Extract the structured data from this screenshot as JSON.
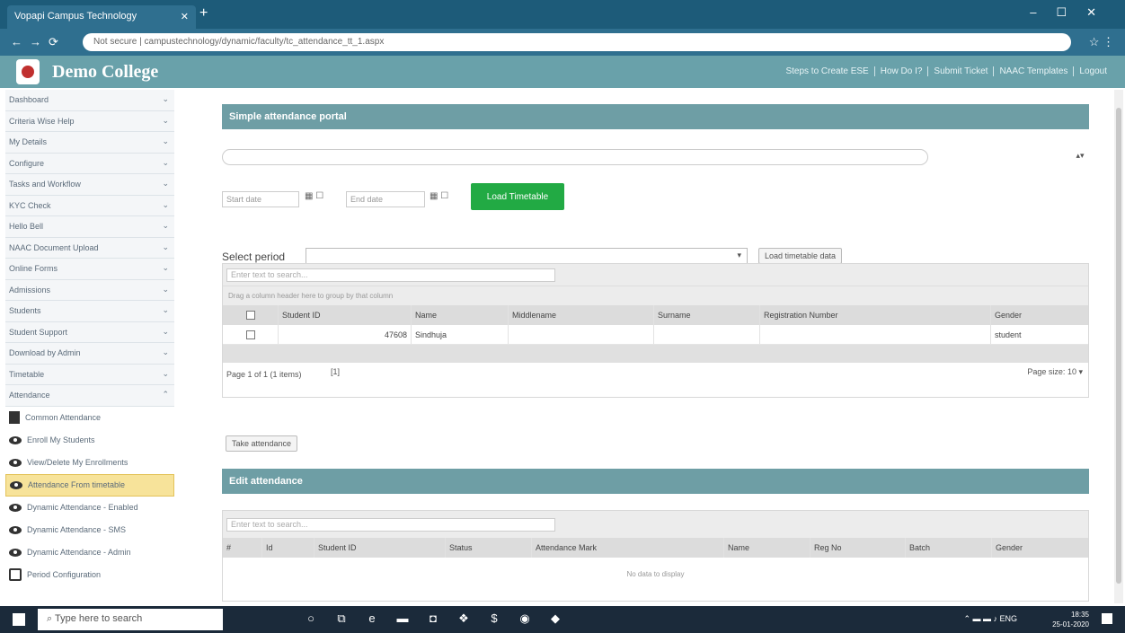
{
  "browser": {
    "tab_title": "Vopapi Campus Technology",
    "url": "Not secure | campustechnology/dynamic/faculty/tc_attendance_tt_1.aspx"
  },
  "header": {
    "college_name": "Demo College",
    "links": [
      "Steps to Create ESE",
      "How Do I?",
      "Submit Ticket",
      "NAAC Templates",
      "Logout"
    ]
  },
  "sidebar": {
    "items": [
      {
        "label": "Dashboard"
      },
      {
        "label": "Criteria Wise Help"
      },
      {
        "label": "My Details"
      },
      {
        "label": "Configure"
      },
      {
        "label": "Tasks and Workflow"
      },
      {
        "label": "KYC Check"
      },
      {
        "label": "Hello Bell"
      },
      {
        "label": "NAAC Document Upload"
      },
      {
        "label": "Online Forms"
      },
      {
        "label": "Admissions"
      },
      {
        "label": "Students"
      },
      {
        "label": "Student Support"
      },
      {
        "label": "Download by Admin"
      },
      {
        "label": "Timetable"
      },
      {
        "label": "Attendance"
      }
    ],
    "subitems": [
      {
        "label": "Common Attendance",
        "icon": "document-icon"
      },
      {
        "label": "Enroll My Students",
        "icon": "eye-icon"
      },
      {
        "label": "View/Delete My Enrollments",
        "icon": "eye-icon"
      },
      {
        "label": "Attendance From timetable",
        "icon": "eye-icon",
        "active": true
      },
      {
        "label": "Dynamic Attendance - Enabled",
        "icon": "eye-icon"
      },
      {
        "label": "Dynamic Attendance - SMS",
        "icon": "eye-icon"
      },
      {
        "label": "Dynamic Attendance - Admin",
        "icon": "eye-icon"
      },
      {
        "label": "Period Configuration",
        "icon": "config-icon"
      }
    ]
  },
  "main": {
    "panel1_title": "Simple attendance portal",
    "start_date_placeholder": "Start date",
    "end_date_placeholder": "End date",
    "load_timetable": "Load Timetable",
    "select_period_label": "Select period",
    "load_timetable_data": "Load timetable data",
    "grid1": {
      "search_placeholder": "Enter text to search...",
      "group_hint": "Drag a column header here to group by that column",
      "columns": [
        "Student ID",
        "Name",
        "Middlename",
        "Surname",
        "Registration Number",
        "Gender"
      ],
      "rows": [
        {
          "student_id": "47608",
          "name": "Sindhuja",
          "middlename": "",
          "surname": "",
          "reg": "",
          "gender": "student"
        }
      ],
      "pager_info": "Page 1 of 1 (1 items)",
      "pager_current": "[1]",
      "page_size_label": "Page size:",
      "page_size": "10"
    },
    "take_attendance": "Take attendance",
    "panel2_title": "Edit attendance",
    "grid2": {
      "search_placeholder": "Enter text to search...",
      "columns": [
        "#",
        "Id",
        "Student ID",
        "Status",
        "Attendance Mark",
        "Name",
        "Reg No",
        "Batch",
        "Gender"
      ],
      "empty": "No data to display"
    }
  },
  "taskbar": {
    "search_placeholder": "Type here to search",
    "time": "18:35",
    "date": "25-01-2020",
    "lang": "ENG"
  }
}
